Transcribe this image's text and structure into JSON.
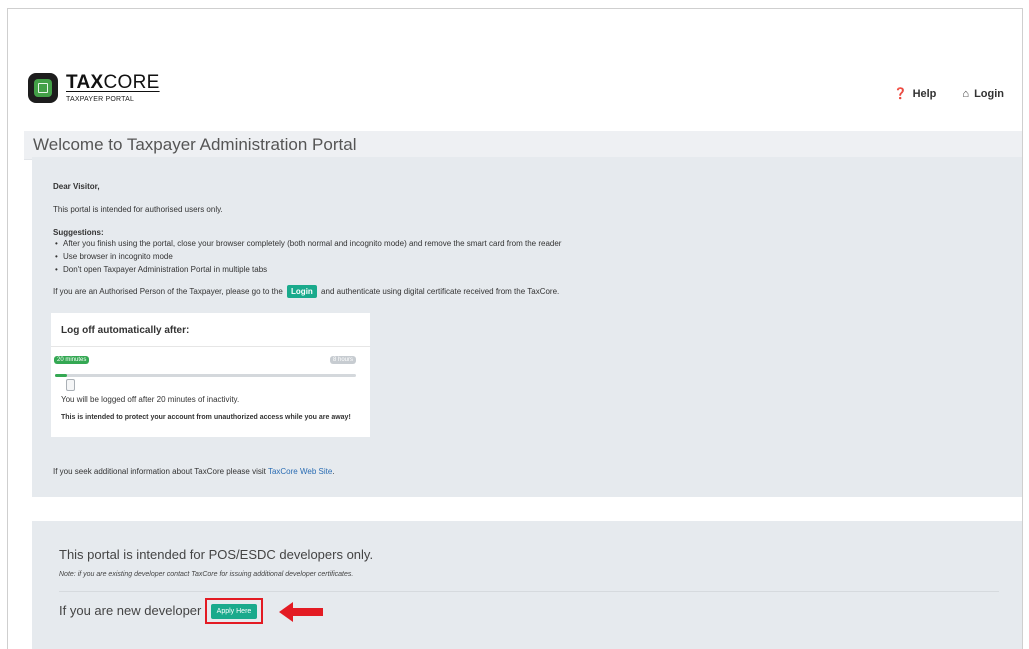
{
  "brand": {
    "name_bold": "TAX",
    "name_rest": "CORE",
    "subtitle": "TAXPAYER PORTAL"
  },
  "nav": {
    "help": "Help",
    "login": "Login"
  },
  "page": {
    "title": "Welcome to Taxpayer Administration Portal"
  },
  "info": {
    "greeting": "Dear Visitor,",
    "intro": "This portal is intended for authorised users only.",
    "suggestions_heading": "Suggestions:",
    "suggestions": [
      "After you finish using the portal, close your browser completely (both normal and incognito mode) and remove the smart card from the reader",
      "Use browser in incognito mode",
      "Don't open Taxpayer Administration Portal in multiple tabs"
    ],
    "auth_before": "If you are an Authorised Person of the Taxpayer, please go to the",
    "auth_login": "Login",
    "auth_after": "and authenticate using digital certificate received from the TaxCore.",
    "more_info_before": "If you seek additional information about TaxCore please visit",
    "more_info_link": "TaxCore Web Site",
    "more_info_after": "."
  },
  "logoff": {
    "title": "Log off automatically after:",
    "min_label": "20 minutes",
    "max_label": "8 hours",
    "slider_fraction": 0.04,
    "status": "You will be logged off after 20 minutes of inactivity.",
    "note": "This is intended to protect your account from unauthorized access while you are away!"
  },
  "developer": {
    "title": "This portal is intended for POS/ESDC developers only.",
    "note_label": "Note:",
    "note_text": "if you are existing developer contact TaxCore for issuing additional developer certificates.",
    "new_dev_text": "If you are new developer",
    "apply_label": "Apply Here"
  },
  "colors": {
    "accent": "#1aaa8c",
    "slider": "#34a853",
    "highlight": "#e31b23"
  }
}
